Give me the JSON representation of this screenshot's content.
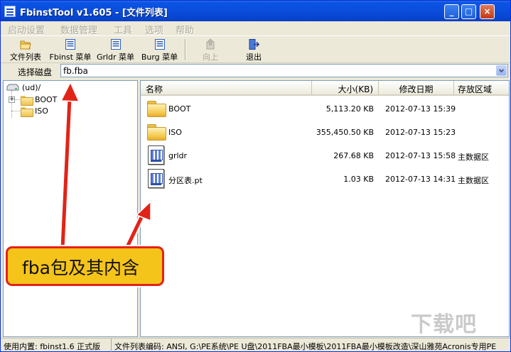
{
  "window": {
    "title": "FbinstTool v1.605 - [文件列表]",
    "controls": {
      "minimize": "_",
      "maximize": "□",
      "close": "×"
    }
  },
  "menu": [
    "启动设置",
    "数据管理",
    "工具",
    "选项",
    "帮助"
  ],
  "toolbar": [
    {
      "label": "文件列表",
      "icon": "folder-open-icon",
      "enabled": true
    },
    {
      "label": "Fbinst 菜单",
      "icon": "menu-doc-icon",
      "enabled": true
    },
    {
      "label": "Grldr 菜单",
      "icon": "menu-doc-icon",
      "enabled": true
    },
    {
      "label": "Burg 菜单",
      "icon": "menu-doc-icon",
      "enabled": true
    },
    {
      "label": "向上",
      "icon": "up-icon",
      "enabled": false
    },
    {
      "label": "退出",
      "icon": "exit-icon",
      "enabled": true
    }
  ],
  "pathbar": {
    "label": "选择磁盘",
    "value": "fb.fba"
  },
  "tree": {
    "root": "(ud)/",
    "children": [
      "BOOT",
      "ISO"
    ]
  },
  "list": {
    "columns": [
      "名称",
      "大小(KB)",
      "修改日期",
      "存放区域"
    ],
    "rows": [
      {
        "name": "BOOT",
        "size": "5,113.20 KB",
        "date": "2012-07-13 15:39",
        "area": "",
        "type": "folder"
      },
      {
        "name": "ISO",
        "size": "355,450.50 KB",
        "date": "2012-07-13 15:23",
        "area": "",
        "type": "folder"
      },
      {
        "name": "grldr",
        "size": "267.68 KB",
        "date": "2012-07-13 15:58",
        "area": "主数据区",
        "type": "file"
      },
      {
        "name": "分区表.pt",
        "size": "1.03 KB",
        "date": "2012-07-13 14:31",
        "area": "主数据区",
        "type": "file"
      }
    ]
  },
  "status": {
    "left": "使用内置: fbinst1.6 正式版",
    "right": "文件列表编码: ANSI, G:\\PE系统\\PE U盘\\2011FBA最小模板\\2011FBA最小模板改造\\深山雅苑Acronis专用PE"
  },
  "annotation": {
    "text": "fba包及其内含"
  },
  "watermark": "下载吧",
  "colors": {
    "titlebar": "#0b4ddc",
    "callout_fill": "#f5c41a",
    "callout_border": "#e22317",
    "arrow": "#e22317"
  }
}
